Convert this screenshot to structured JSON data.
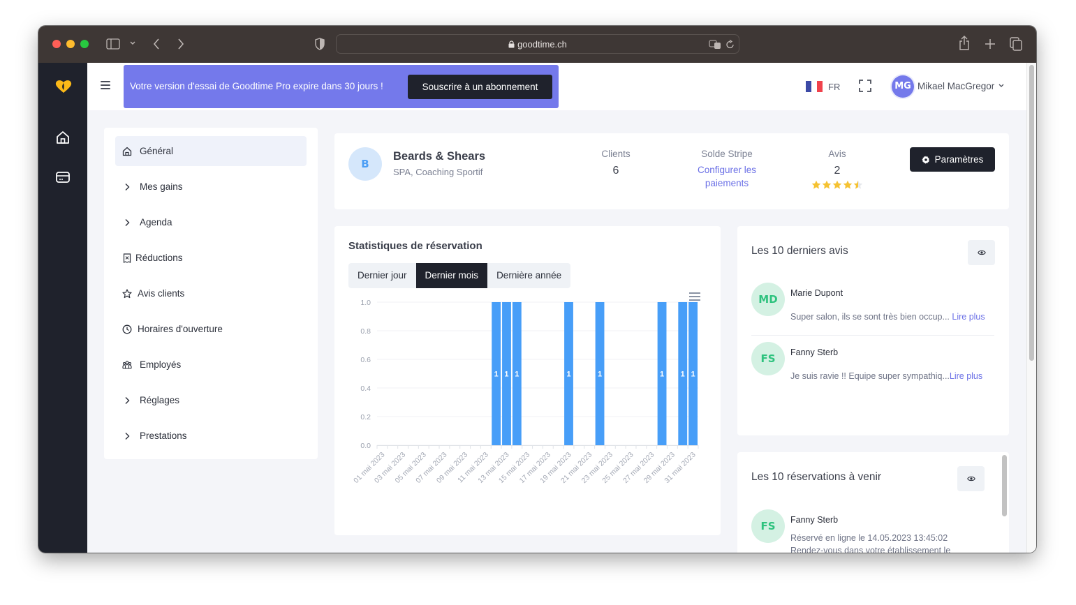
{
  "browser": {
    "url": "goodtime.ch",
    "icons": [
      "sidebar-icon",
      "chevron-down-icon",
      "back-icon",
      "forward-icon",
      "shield-icon",
      "lock-icon",
      "translate-icon",
      "reload-icon",
      "share-icon",
      "new-tab-icon",
      "tabs-overview-icon"
    ]
  },
  "rail": {
    "items": [
      {
        "icon": "logo-icon"
      },
      {
        "icon": "home-icon"
      },
      {
        "icon": "card-icon"
      }
    ]
  },
  "topbar": {
    "trial_message": "Votre version d'essai de Goodtime Pro expire dans 30 jours !",
    "subscribe_label": "Souscrire à un abonnement",
    "language": "FR",
    "flag_colors": [
      "#3c4aa6",
      "#ffffff",
      "#f0424c"
    ],
    "user_initials": "MG",
    "user_name": "Mikael MacGregor"
  },
  "menu": {
    "items": [
      {
        "label": "Général",
        "icon": "home-icon",
        "active": true
      },
      {
        "label": "Mes gains",
        "icon": "chevron-right-icon",
        "active": false
      },
      {
        "label": "Agenda",
        "icon": "chevron-right-icon",
        "active": false
      },
      {
        "label": "Réductions",
        "icon": "receipt-icon",
        "active": false
      },
      {
        "label": "Avis clients",
        "icon": "star-icon",
        "active": false
      },
      {
        "label": "Horaires d'ouverture",
        "icon": "clock-icon",
        "active": false
      },
      {
        "label": "Employés",
        "icon": "people-icon",
        "active": false
      },
      {
        "label": "Réglages",
        "icon": "chevron-right-icon",
        "active": false
      },
      {
        "label": "Prestations",
        "icon": "chevron-right-icon",
        "active": false
      }
    ]
  },
  "business": {
    "initial": "B",
    "name": "Beards & Shears",
    "category": "SPA, Coaching Sportif",
    "clients_label": "Clients",
    "clients_value": "6",
    "stripe_label": "Solde Stripe",
    "stripe_link_line1": "Configurer les",
    "stripe_link_line2": "paiements",
    "reviews_label": "Avis",
    "reviews_value": "2",
    "rating": 4.5,
    "rating_max": 5,
    "settings_label": "Paramètres"
  },
  "stats": {
    "title": "Statistiques de réservation",
    "tabs": [
      {
        "label": "Dernier jour",
        "active": false
      },
      {
        "label": "Dernier mois",
        "active": true
      },
      {
        "label": "Dernière année",
        "active": false
      }
    ]
  },
  "chart_data": {
    "type": "bar",
    "title": "",
    "xlabel": "",
    "ylabel": "",
    "ylim": [
      0,
      1.0
    ],
    "yticks": [
      "0.0",
      "0.2",
      "0.4",
      "0.6",
      "0.8",
      "1.0"
    ],
    "grid": true,
    "color": "#479ef8",
    "categories": [
      "01 mai 2023",
      "02 mai 2023",
      "03 mai 2023",
      "04 mai 2023",
      "05 mai 2023",
      "06 mai 2023",
      "07 mai 2023",
      "08 mai 2023",
      "09 mai 2023",
      "10 mai 2023",
      "11 mai 2023",
      "12 mai 2023",
      "13 mai 2023",
      "14 mai 2023",
      "15 mai 2023",
      "16 mai 2023",
      "17 mai 2023",
      "18 mai 2023",
      "19 mai 2023",
      "20 mai 2023",
      "21 mai 2023",
      "22 mai 2023",
      "23 mai 2023",
      "24 mai 2023",
      "25 mai 2023",
      "26 mai 2023",
      "27 mai 2023",
      "28 mai 2023",
      "29 mai 2023",
      "30 mai 2023",
      "31 mai 2023"
    ],
    "xtick_labels": [
      "01 mai 2023",
      "03 mai 2023",
      "05 mai 2023",
      "07 mai 2023",
      "09 mai 2023",
      "11 mai 2023",
      "13 mai 2023",
      "15 mai 2023",
      "17 mai 2023",
      "19 mai 2023",
      "21 mai 2023",
      "23 mai 2023",
      "25 mai 2023",
      "27 mai 2023",
      "29 mai 2023",
      "31 mai 2023"
    ],
    "values": [
      0,
      0,
      0,
      0,
      0,
      0,
      0,
      0,
      0,
      0,
      0,
      1,
      1,
      1,
      0,
      0,
      0,
      0,
      1,
      0,
      0,
      1,
      0,
      0,
      0,
      0,
      0,
      1,
      0,
      1,
      1
    ],
    "data_labels": true
  },
  "reviews": {
    "title": "Les 10 derniers avis",
    "items": [
      {
        "initials": "MD",
        "name": "Marie Dupont",
        "text": "Super salon, ils se sont très bien occup...",
        "link": "Lire plus"
      },
      {
        "initials": "FS",
        "name": "Fanny Sterb",
        "text": "Je suis ravie !! Equipe super sympathiq...",
        "link": "Lire plus"
      }
    ]
  },
  "upcoming": {
    "title": "Les 10 réservations à venir",
    "items": [
      {
        "initials": "FS",
        "name": "Fanny Sterb",
        "line1": "Réservé en ligne le 14.05.2023 13:45:02",
        "line2": "Rendez-vous dans votre établissement le"
      }
    ]
  }
}
